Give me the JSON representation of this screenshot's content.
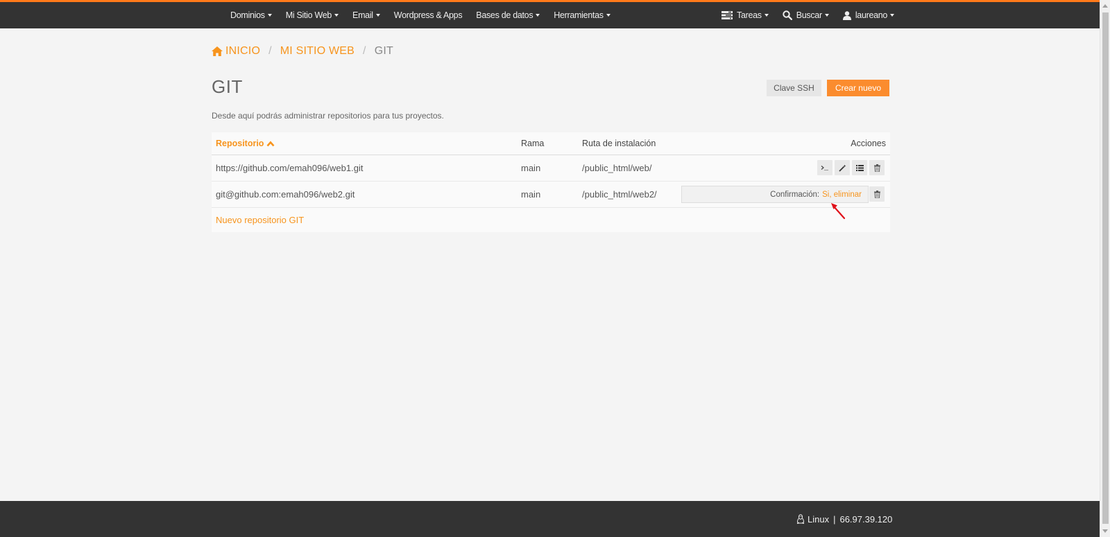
{
  "nav": {
    "left": [
      {
        "label": "Dominios"
      },
      {
        "label": "Mi Sitio Web"
      },
      {
        "label": "Email"
      },
      {
        "label": "Wordpress & Apps"
      },
      {
        "label": "Bases de datos"
      },
      {
        "label": "Herramientas"
      }
    ],
    "right": {
      "tasks": {
        "label": "Tareas",
        "icon": "tasks-icon"
      },
      "search": {
        "label": "Buscar",
        "icon": "search-icon"
      },
      "user": {
        "label": "laureano",
        "icon": "user-icon"
      }
    }
  },
  "breadcrumb": {
    "home": "INICIO",
    "site": "MI SITIO WEB",
    "current": "GIT",
    "separator": "/"
  },
  "page": {
    "title": "GIT",
    "description": "Desde aquí podrás administrar repositorios para tus proyectos.",
    "ssh_button": "Clave SSH",
    "new_button": "Crear nuevo"
  },
  "table": {
    "headers": {
      "repo": "Repositorio",
      "branch": "Rama",
      "path": "Ruta de instalación",
      "actions": "Acciones"
    },
    "rows": [
      {
        "repo": "https://github.com/emah096/web1.git",
        "branch": "main",
        "path": "/public_html/web/"
      },
      {
        "repo": "git@github.com:emah096/web2.git",
        "branch": "main",
        "path": "/public_html/web2/"
      }
    ],
    "confirm_label": "Confirmación:",
    "confirm_link": "Si, eliminar",
    "new_repo_link": "Nuevo repositorio GIT"
  },
  "footer": {
    "os": "Linux",
    "separator": "|",
    "ip": "66.97.39.120"
  },
  "colors": {
    "accent": "#f7941d",
    "navbar": "#333333",
    "annotation_arrow": "#e0101a"
  }
}
